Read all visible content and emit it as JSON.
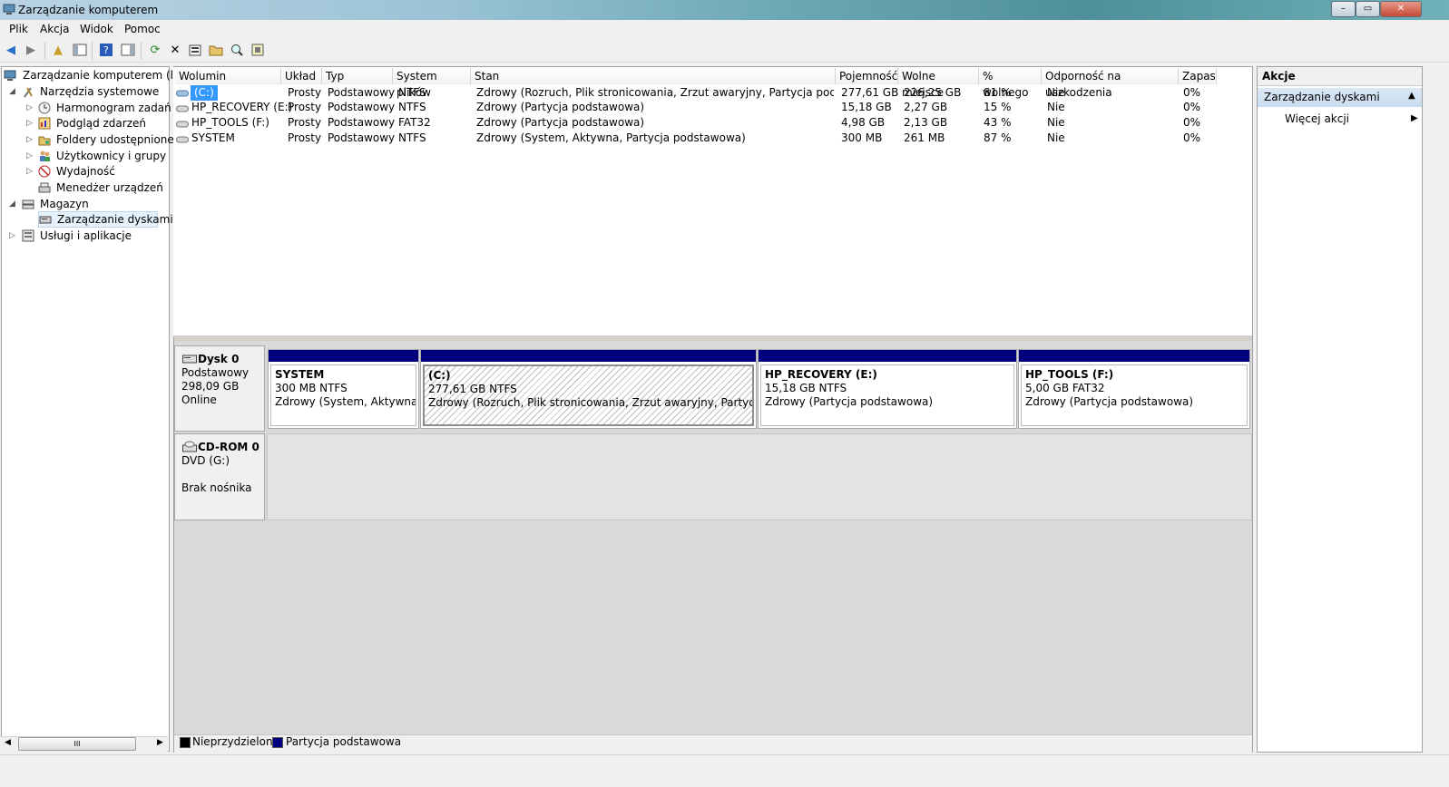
{
  "window": {
    "title": "Zarządzanie komputerem"
  },
  "menu": [
    "Plik",
    "Akcja",
    "Widok",
    "Pomoc"
  ],
  "tree": {
    "root": "Zarządzanie komputerem (loka",
    "items": [
      {
        "label": "Narzędzia systemowe"
      },
      {
        "label": "Harmonogram zadań"
      },
      {
        "label": "Podgląd zdarzeń"
      },
      {
        "label": "Foldery udostępnione"
      },
      {
        "label": "Użytkownicy i grupy lok"
      },
      {
        "label": "Wydajność"
      },
      {
        "label": "Menedżer urządzeń"
      },
      {
        "label": "Magazyn"
      },
      {
        "label": "Zarządzanie dyskami"
      },
      {
        "label": "Usługi i aplikacje"
      }
    ],
    "scroll_grip": "III"
  },
  "volume_table": {
    "columns": [
      "Wolumin",
      "Układ",
      "Typ",
      "System plików",
      "Stan",
      "Pojemność",
      "Wolne miejsce",
      "% wolnego",
      "Odporność na uszkodzenia",
      "Zapas"
    ],
    "rows": [
      [
        "(C:)",
        "Prosty",
        "Podstawowy",
        "NTFS",
        "Zdrowy (Rozruch, Plik stronicowania, Zrzut awaryjny, Partycja podstawowa)",
        "277,61 GB",
        "226,25 GB",
        "81 %",
        "Nie",
        "0%"
      ],
      [
        "HP_RECOVERY (E:)",
        "Prosty",
        "Podstawowy",
        "NTFS",
        "Zdrowy (Partycja podstawowa)",
        "15,18 GB",
        "2,27 GB",
        "15 %",
        "Nie",
        "0%"
      ],
      [
        "HP_TOOLS (F:)",
        "Prosty",
        "Podstawowy",
        "FAT32",
        "Zdrowy (Partycja podstawowa)",
        "4,98 GB",
        "2,13 GB",
        "43 %",
        "Nie",
        "0%"
      ],
      [
        "SYSTEM",
        "Prosty",
        "Podstawowy",
        "NTFS",
        "Zdrowy (System, Aktywna, Partycja podstawowa)",
        "300 MB",
        "261 MB",
        "87 %",
        "Nie",
        "0%"
      ]
    ]
  },
  "disk0": {
    "name": "Dysk 0",
    "type": "Podstawowy",
    "size": "298,09 GB",
    "status": "Online",
    "partitions": [
      {
        "name": "SYSTEM",
        "size": "300 MB NTFS",
        "status": "Zdrowy (System, Aktywna, Pa"
      },
      {
        "name": "(C:)",
        "size": "277,61 GB NTFS",
        "status": "Zdrowy (Rozruch, Plik stronicowania, Zrzut awaryjny, Partycja podsta"
      },
      {
        "name": "HP_RECOVERY  (E:)",
        "size": "15,18 GB NTFS",
        "status": "Zdrowy (Partycja podstawowa)"
      },
      {
        "name": "HP_TOOLS  (F:)",
        "size": "5,00 GB FAT32",
        "status": "Zdrowy (Partycja podstawowa)"
      }
    ]
  },
  "cdrom0": {
    "name": "CD-ROM 0",
    "drive": "DVD (G:)",
    "status": "Brak nośnika"
  },
  "legend": {
    "unallocated": "Nieprzydzielone",
    "primary": "Partycja podstawowa"
  },
  "actions": {
    "title": "Akcje",
    "section": "Zarządzanie dyskami",
    "more": "Więcej akcji"
  },
  "colors": {
    "primary_partition": "#00007e",
    "unallocated": "#000000",
    "selection": "#3399ff"
  }
}
